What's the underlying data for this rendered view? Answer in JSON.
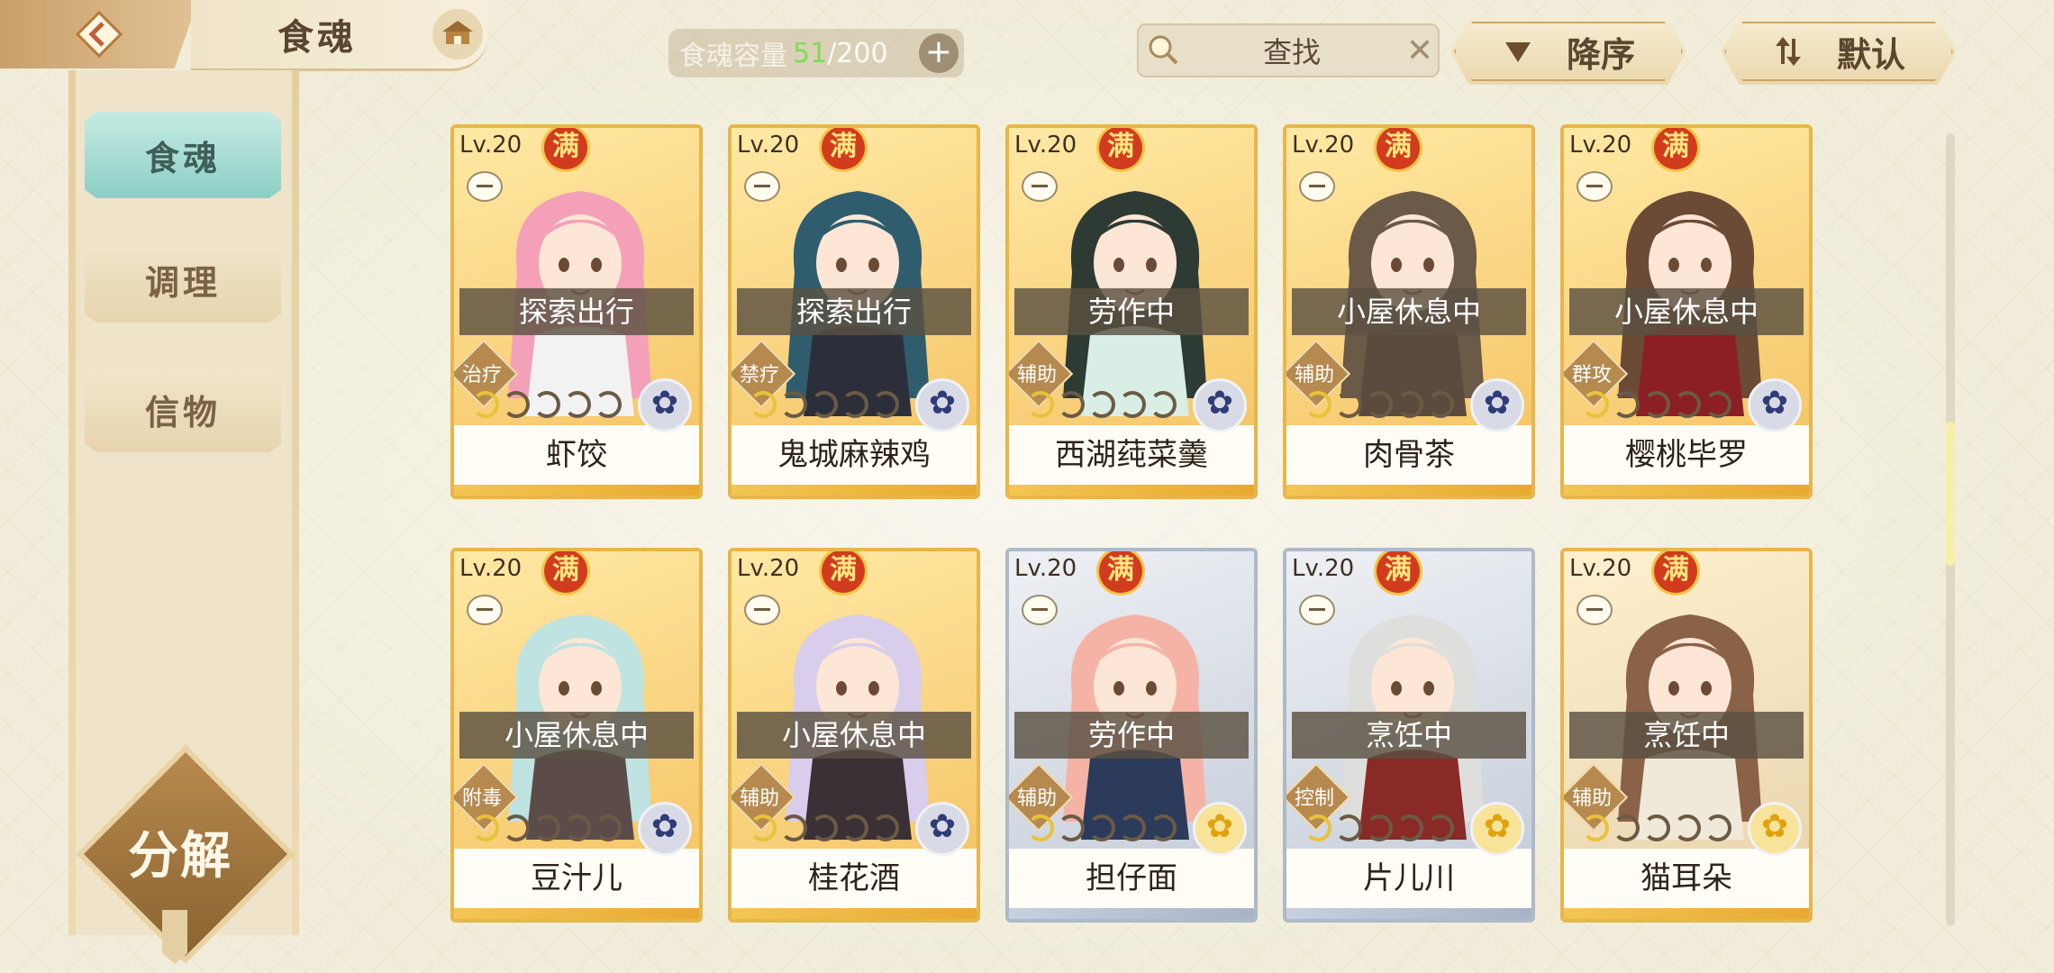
{
  "header": {
    "title": "食魂",
    "capacity_label": "食魂容量",
    "capacity_current": "51",
    "capacity_max": "/200",
    "search_placeholder": "查找",
    "sort_order": "降序",
    "sort_default": "默认"
  },
  "sidebar": {
    "tabs": [
      {
        "label": "食魂",
        "active": true
      },
      {
        "label": "调理",
        "active": false
      },
      {
        "label": "信物",
        "active": false
      }
    ],
    "decompose_label": "分解"
  },
  "cards": [
    {
      "level": "Lv.20",
      "full": "满",
      "status": "探索出行",
      "role": "治疗",
      "name": "虾饺",
      "frame": "gold",
      "element": "blue"
    },
    {
      "level": "Lv.20",
      "full": "满",
      "status": "探索出行",
      "role": "禁疗",
      "name": "鬼城麻辣鸡",
      "frame": "gold",
      "element": "blue"
    },
    {
      "level": "Lv.20",
      "full": "满",
      "status": "劳作中",
      "role": "辅助",
      "name": "西湖莼菜羹",
      "frame": "gold",
      "element": "blue"
    },
    {
      "level": "Lv.20",
      "full": "满",
      "status": "小屋休息中",
      "role": "辅助",
      "name": "肉骨茶",
      "frame": "gold",
      "element": "blue"
    },
    {
      "level": "Lv.20",
      "full": "满",
      "status": "小屋休息中",
      "role": "群攻",
      "name": "樱桃毕罗",
      "frame": "gold",
      "element": "blue"
    },
    {
      "level": "Lv.20",
      "full": "满",
      "status": "小屋休息中",
      "role": "附毒",
      "name": "豆汁儿",
      "frame": "gold",
      "element": "blue"
    },
    {
      "level": "Lv.20",
      "full": "满",
      "status": "小屋休息中",
      "role": "辅助",
      "name": "桂花酒",
      "frame": "gold",
      "element": "blue"
    },
    {
      "level": "Lv.20",
      "full": "满",
      "status": "劳作中",
      "role": "辅助",
      "name": "担仔面",
      "frame": "blue",
      "element": "gold"
    },
    {
      "level": "Lv.20",
      "full": "满",
      "status": "烹饪中",
      "role": "控制",
      "name": "片儿川",
      "frame": "blue",
      "element": "gold"
    },
    {
      "level": "Lv.20",
      "full": "满",
      "status": "烹饪中",
      "role": "辅助",
      "name": "猫耳朵",
      "frame": "cream",
      "element": "gold"
    }
  ],
  "colors": {
    "accent_teal": "#8ccfc6",
    "gold_frame": "#e7b64a",
    "capacity_green": "#7fdb57"
  }
}
